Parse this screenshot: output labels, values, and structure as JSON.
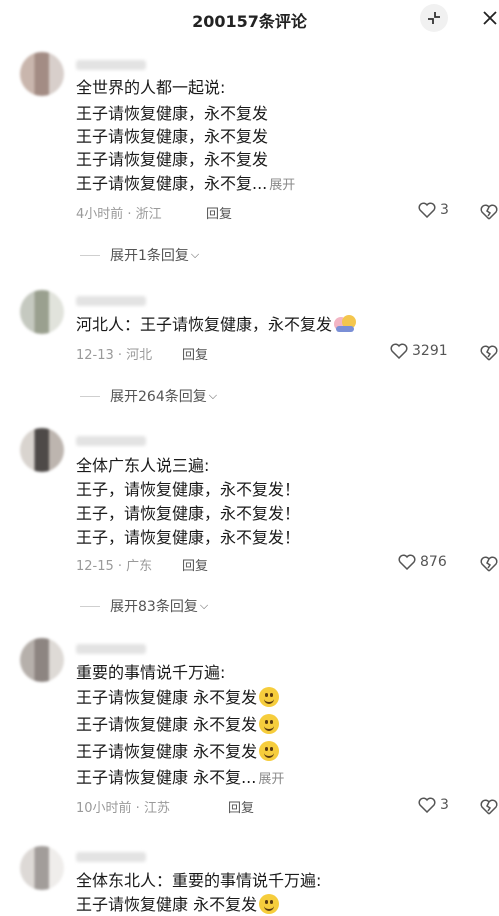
{
  "header": {
    "title": "200157条评论"
  },
  "comments": [
    {
      "lines": [
        "全世界的人都一起说:",
        "王子请恢复健康，永不复发",
        "王子请恢复健康，永不复发",
        "王子请恢复健康，永不复发",
        "王子请恢复健康，永不复..."
      ],
      "expand": "展开",
      "time_location": "4小时前 · 浙江",
      "reply": "回复",
      "likes": "3",
      "replies": "展开1条回复"
    },
    {
      "lines": [
        "河北人：王子请恢复健康，永不复发"
      ],
      "time_location": "12-13 · 河北",
      "reply": "回复",
      "likes": "3291",
      "replies": "展开264条回复"
    },
    {
      "lines": [
        "全体广东人说三遍:",
        "王子，请恢复健康，永不复发！",
        "王子，请恢复健康，永不复发！",
        "王子，请恢复健康，永不复发！"
      ],
      "time_location": "12-15 · 广东",
      "reply": "回复",
      "likes": "876",
      "replies": "展开83条回复"
    },
    {
      "lines": [
        "重要的事情说千万遍:",
        "王子请恢复健康 永不复发",
        "王子请恢复健康 永不复发",
        "王子请恢复健康 永不复发",
        "王子请恢复健康 永不复..."
      ],
      "expand": "展开",
      "time_location": "10小时前 · 江苏",
      "reply": "回复",
      "likes": "3"
    },
    {
      "lines": [
        "全体东北人：重要的事情说千万遍:",
        "王子请恢复健康 永不复发"
      ]
    }
  ]
}
